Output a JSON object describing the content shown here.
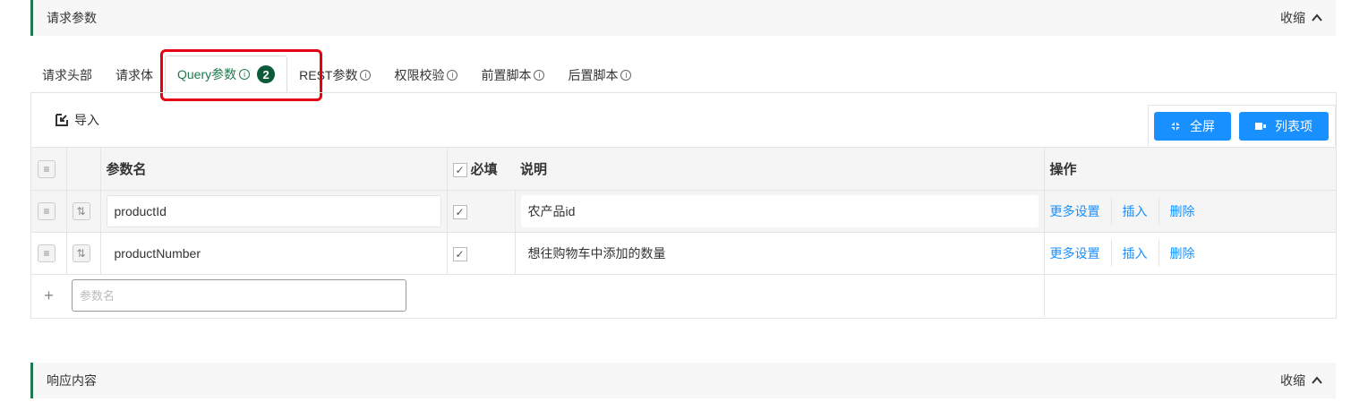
{
  "request_section": {
    "title": "请求参数",
    "collapse_label": "收缩"
  },
  "response_section": {
    "title": "响应内容",
    "collapse_label": "收缩"
  },
  "tabs": [
    {
      "label": "请求头部",
      "info": false
    },
    {
      "label": "请求体",
      "info": false
    },
    {
      "label": "Query参数",
      "info": true,
      "badge": "2",
      "active": true
    },
    {
      "label": "REST参数",
      "info": true
    },
    {
      "label": "权限校验",
      "info": true
    },
    {
      "label": "前置脚本",
      "info": true
    },
    {
      "label": "后置脚本",
      "info": true
    }
  ],
  "toolbar": {
    "import_label": "导入",
    "fullscreen_label": "全屏",
    "columns_label": "列表项"
  },
  "table": {
    "headers": {
      "name": "参数名",
      "required": "必填",
      "description": "说明",
      "actions": "操作"
    },
    "rows": [
      {
        "name": "productId",
        "required": true,
        "description": "农产品id"
      },
      {
        "name": "productNumber",
        "required": true,
        "description": "想往购物车中添加的数量"
      }
    ],
    "row_actions": {
      "more": "更多设置",
      "insert": "插入",
      "delete": "删除"
    },
    "new_row_placeholder": "参数名"
  },
  "colors": {
    "accent_green": "#1f7a4d",
    "link_blue": "#1890ff",
    "highlight_red": "#e60012"
  }
}
